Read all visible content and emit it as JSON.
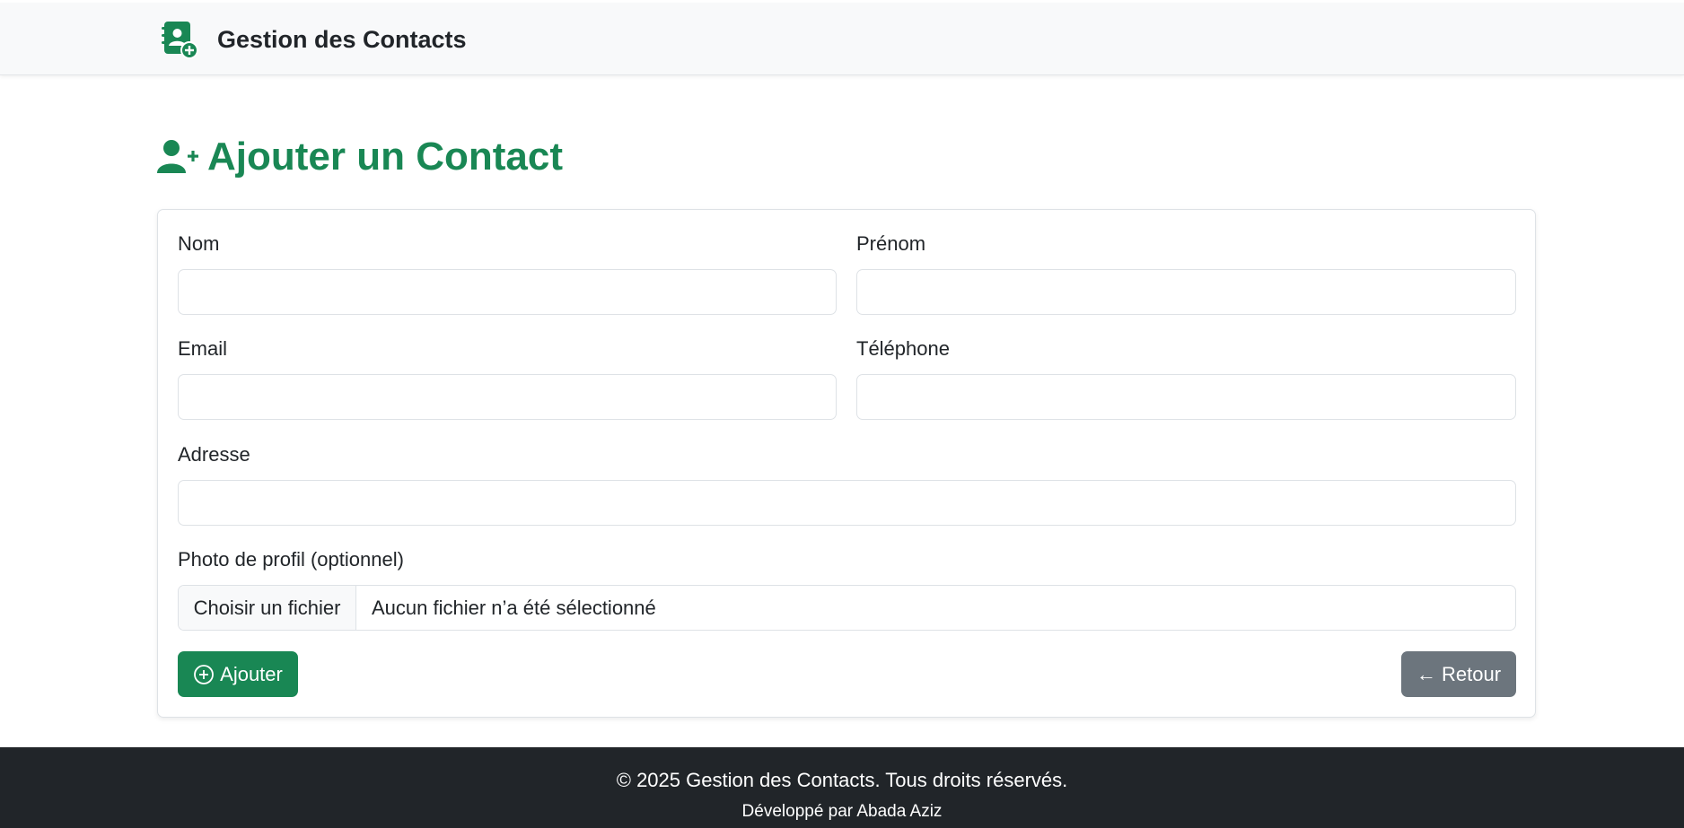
{
  "navbar": {
    "brand_text": "Gestion des Contacts",
    "brand_icon": "address-book-add-icon"
  },
  "page": {
    "title": "Ajouter un Contact",
    "title_icon": "user-plus-icon"
  },
  "form": {
    "fields": {
      "nom": {
        "label": "Nom",
        "value": "",
        "placeholder": ""
      },
      "prenom": {
        "label": "Prénom",
        "value": "",
        "placeholder": ""
      },
      "email": {
        "label": "Email",
        "value": "",
        "placeholder": ""
      },
      "telephone": {
        "label": "Téléphone",
        "value": "",
        "placeholder": ""
      },
      "adresse": {
        "label": "Adresse",
        "value": "",
        "placeholder": ""
      }
    },
    "photo": {
      "label": "Photo de profil (optionnel)",
      "button_label": "Choisir un fichier",
      "status": "Aucun fichier n’a été sélectionné"
    },
    "submit_label": "Ajouter",
    "back_label": "← Retour"
  },
  "footer": {
    "copyright": "© 2025 Gestion des Contacts. Tous droits réservés.",
    "credit": "Développé par Abada Aziz"
  },
  "colors": {
    "accent": "#198754",
    "secondary": "#6c757d",
    "footer_bg": "#212529",
    "navbar_bg": "#f8f9fa"
  }
}
